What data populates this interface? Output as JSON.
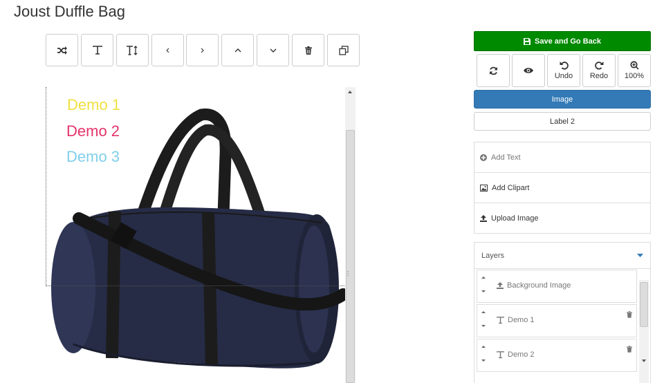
{
  "page": {
    "title": "Joust Duffle Bag"
  },
  "toolbar": {
    "buttons": [
      {
        "icon": "shuffle-icon"
      },
      {
        "icon": "text-icon"
      },
      {
        "icon": "text-height-icon"
      },
      {
        "icon": "chevron-left-icon",
        "glyph": "‹"
      },
      {
        "icon": "chevron-right-icon",
        "glyph": "›"
      },
      {
        "icon": "chevron-up-icon"
      },
      {
        "icon": "chevron-down-icon"
      },
      {
        "icon": "trash-icon"
      },
      {
        "icon": "duplicate-icon"
      }
    ]
  },
  "canvas": {
    "texts": [
      {
        "label": "Demo 1",
        "color": "#f0e040"
      },
      {
        "label": "Demo 2",
        "color": "#e5336a"
      },
      {
        "label": "Demo 3",
        "color": "#7fcfea"
      }
    ],
    "product_image": "duffle-bag-navy"
  },
  "actions": {
    "save_label": "Save and Go Back",
    "undo_label": "Undo",
    "redo_label": "Redo",
    "zoom_label": "100%"
  },
  "tabs": {
    "image_label": "Image",
    "label2_label": "Label 2"
  },
  "add_panel": {
    "add_text": "Add Text",
    "add_clipart": "Add Clipart",
    "upload_image": "Upload Image"
  },
  "layers": {
    "title": "Layers",
    "items": [
      {
        "name": "Background Image",
        "icon": "upload-icon"
      },
      {
        "name": "Demo 1",
        "icon": "text-icon"
      },
      {
        "name": "Demo 2",
        "icon": "text-icon"
      }
    ]
  },
  "colors": {
    "save": "#008a00",
    "accent": "#337ab7",
    "bag": "#262c46",
    "strap": "#1c1c1c"
  }
}
